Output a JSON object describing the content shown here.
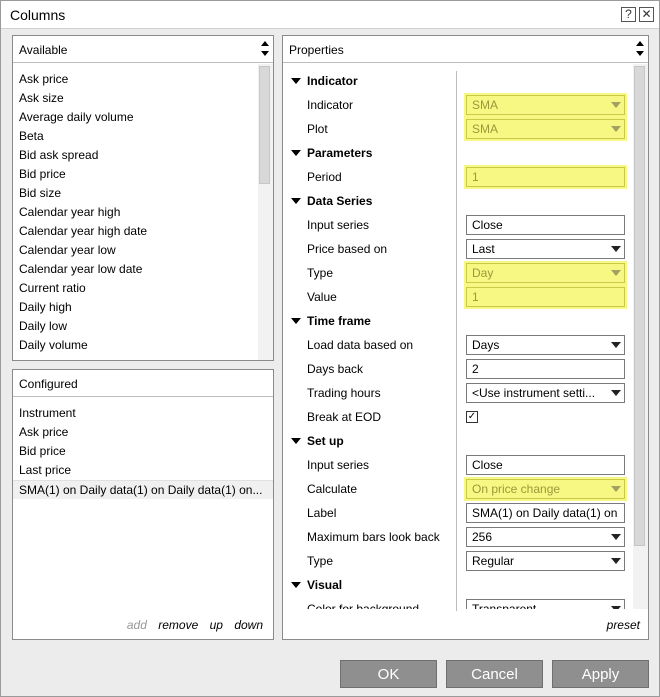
{
  "window": {
    "title": "Columns",
    "help_glyph": "?",
    "close_glyph": "✕"
  },
  "available": {
    "header": "Available",
    "items": [
      "Ask price",
      "Ask size",
      "Average daily volume",
      "Beta",
      "Bid ask spread",
      "Bid price",
      "Bid size",
      "Calendar year high",
      "Calendar year high date",
      "Calendar year low",
      "Calendar year low date",
      "Current ratio",
      "Daily high",
      "Daily low",
      "Daily volume"
    ]
  },
  "configured": {
    "header": "Configured",
    "items": [
      "Instrument",
      "Ask price",
      "Bid price",
      "Last price",
      "SMA(1) on Daily data(1) on Daily data(1) on..."
    ],
    "links": {
      "add": "add",
      "remove": "remove",
      "up": "up",
      "down": "down"
    }
  },
  "properties": {
    "header": "Properties",
    "preset_link": "preset",
    "rows": [
      {
        "kind": "cat",
        "label": "Indicator"
      },
      {
        "kind": "prop",
        "label": "Indicator",
        "value": "SMA",
        "control": "dropdown",
        "highlight": true
      },
      {
        "kind": "prop",
        "label": "Plot",
        "value": "SMA",
        "control": "dropdown",
        "highlight": true
      },
      {
        "kind": "cat",
        "label": "Parameters"
      },
      {
        "kind": "prop",
        "label": "Period",
        "value": "1",
        "control": "text",
        "highlight": true
      },
      {
        "kind": "cat",
        "label": "Data Series"
      },
      {
        "kind": "prop",
        "label": "Input series",
        "value": "Close",
        "control": "text",
        "highlight": false
      },
      {
        "kind": "prop",
        "label": "Price based on",
        "value": "Last",
        "control": "dropdown",
        "highlight": false
      },
      {
        "kind": "prop",
        "label": "Type",
        "value": "Day",
        "control": "dropdown",
        "highlight": true
      },
      {
        "kind": "prop",
        "label": "Value",
        "value": "1",
        "control": "text",
        "highlight": true
      },
      {
        "kind": "cat",
        "label": "Time frame"
      },
      {
        "kind": "prop",
        "label": "Load data based on",
        "value": "Days",
        "control": "dropdown",
        "highlight": false
      },
      {
        "kind": "prop",
        "label": "Days back",
        "value": "2",
        "control": "text",
        "highlight": false
      },
      {
        "kind": "prop",
        "label": "Trading hours",
        "value": "<Use instrument setti...",
        "control": "dropdown",
        "highlight": false
      },
      {
        "kind": "prop",
        "label": "Break at EOD",
        "value": "✓",
        "control": "checkbox",
        "highlight": false
      },
      {
        "kind": "cat",
        "label": "Set up"
      },
      {
        "kind": "prop",
        "label": "Input series",
        "value": "Close",
        "control": "text",
        "highlight": false
      },
      {
        "kind": "prop",
        "label": "Calculate",
        "value": "On price change",
        "control": "dropdown",
        "highlight": true
      },
      {
        "kind": "prop",
        "label": "Label",
        "value": "SMA(1) on Daily data(1) on",
        "control": "text",
        "highlight": false
      },
      {
        "kind": "prop",
        "label": "Maximum bars look back",
        "value": "256",
        "control": "dropdown",
        "highlight": false
      },
      {
        "kind": "prop",
        "label": "Type",
        "value": "Regular",
        "control": "dropdown",
        "highlight": false
      },
      {
        "kind": "cat",
        "label": "Visual"
      },
      {
        "kind": "prop",
        "label": "Color for background",
        "value": "Transparent",
        "control": "dropdown",
        "highlight": false
      }
    ]
  },
  "buttons": {
    "ok": "OK",
    "cancel": "Cancel",
    "apply": "Apply"
  },
  "colors": {
    "highlight": "#f7f783",
    "button": "#8f8f8f"
  }
}
